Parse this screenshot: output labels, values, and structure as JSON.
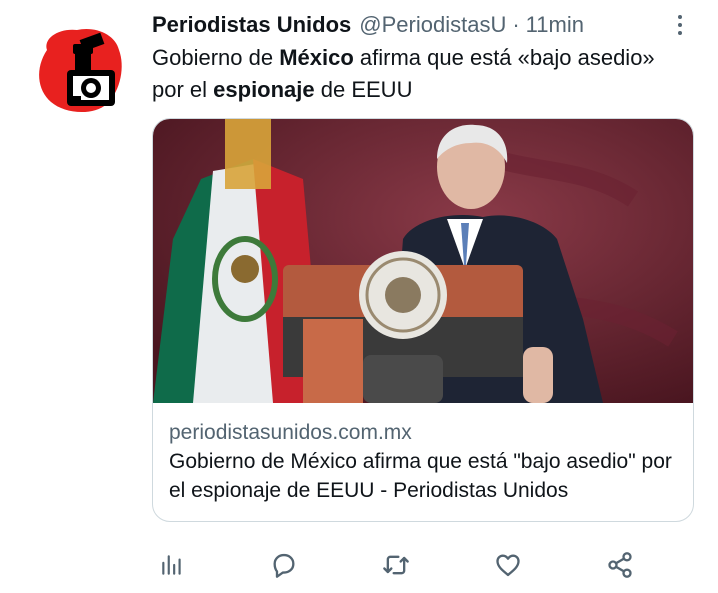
{
  "tweet": {
    "name": "Periodistas Unidos",
    "handle": "@PeriodistasU",
    "separator": "·",
    "time": "11min",
    "text": {
      "p1": "Gobierno de ",
      "b1": "México",
      "p2": " afirma que está «bajo asedio» por el ",
      "b2": "espionaje",
      "p3": " de EEUU"
    }
  },
  "card": {
    "domain": "periodistasunidos.com.mx",
    "title": "Gobierno de México afirma que está \"bajo asedio\" por el espionaje de EEUU - Periodistas Unidos"
  },
  "icons": {
    "avatar": "periodistas-unidos-logo",
    "more": "more-vertical-icon",
    "analytics": "analytics-icon",
    "reply": "reply-icon",
    "retweet": "retweet-icon",
    "like": "heart-icon",
    "share": "share-icon"
  },
  "colors": {
    "logo_red": "#e8211f",
    "secondary_text": "#536471",
    "border": "#cfd9de",
    "icon_gray": "#536471"
  }
}
